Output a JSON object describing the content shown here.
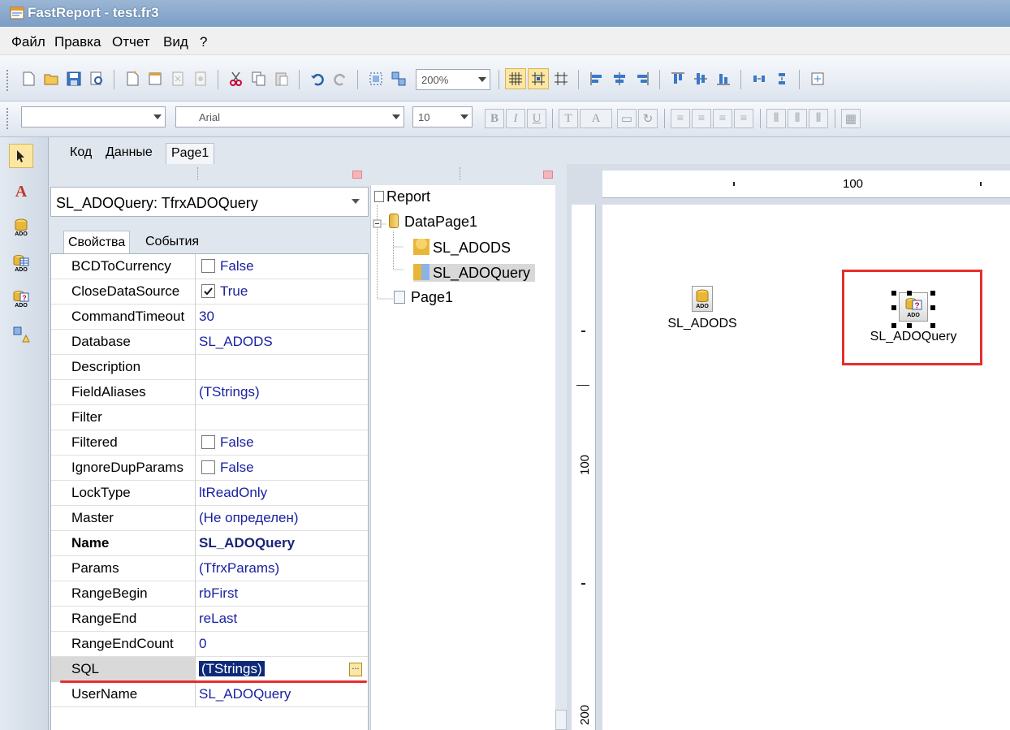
{
  "window": {
    "title": "FastReport - test.fr3"
  },
  "menu": [
    "Файл",
    "Правка",
    "Отчет",
    "Вид",
    "?"
  ],
  "toolbar": {
    "zoom": "200%",
    "style_combo": "",
    "font_name": "Arial",
    "font_size": "10",
    "bold_label": "B",
    "italic_label": "I",
    "underline_label": "U"
  },
  "tabs": [
    {
      "label": "Код"
    },
    {
      "label": "Данные"
    },
    {
      "label": "Page1"
    }
  ],
  "inspector": {
    "object_combo": "SL_ADOQuery: TfrxADOQuery",
    "tabs": [
      "Свойства",
      "События"
    ],
    "props": [
      {
        "name": "BCDToCurrency",
        "value": "False",
        "check": "off"
      },
      {
        "name": "CloseDataSource",
        "value": "True",
        "check": "on"
      },
      {
        "name": "CommandTimeout",
        "value": "30"
      },
      {
        "name": "Database",
        "value": "SL_ADODS"
      },
      {
        "name": "Description",
        "value": ""
      },
      {
        "name": "FieldAliases",
        "value": "(TStrings)"
      },
      {
        "name": "Filter",
        "value": ""
      },
      {
        "name": "Filtered",
        "value": "False",
        "check": "off"
      },
      {
        "name": "IgnoreDupParams",
        "value": "False",
        "check": "off"
      },
      {
        "name": "LockType",
        "value": "ltReadOnly"
      },
      {
        "name": "Master",
        "value": "(Не определен)"
      },
      {
        "name": "Name",
        "value": "SL_ADOQuery",
        "bold": true
      },
      {
        "name": "Params",
        "value": "(TfrxParams)"
      },
      {
        "name": "RangeBegin",
        "value": "rbFirst"
      },
      {
        "name": "RangeEnd",
        "value": "reLast"
      },
      {
        "name": "RangeEndCount",
        "value": "0"
      },
      {
        "name": "SQL",
        "value": "(TStrings)",
        "selected": true,
        "ellipsis": "..."
      },
      {
        "name": "UserName",
        "value": "SL_ADOQuery"
      }
    ]
  },
  "tree": {
    "root": "Report",
    "datapage": "DataPage1",
    "ds1": "SL_ADODS",
    "ds2": "SL_ADOQuery",
    "page": "Page1"
  },
  "design": {
    "hruler_label": "100",
    "vruler_labels": [
      "100",
      "200"
    ],
    "objects": [
      {
        "label": "SL_ADODS",
        "icon_text": "ADO"
      },
      {
        "label": "SL_ADOQuery",
        "icon_text": "ADO"
      }
    ]
  },
  "colors": {
    "highlight": "#e62e2e",
    "selection": "#0d2a7a",
    "value_text": "#1a22a0"
  }
}
